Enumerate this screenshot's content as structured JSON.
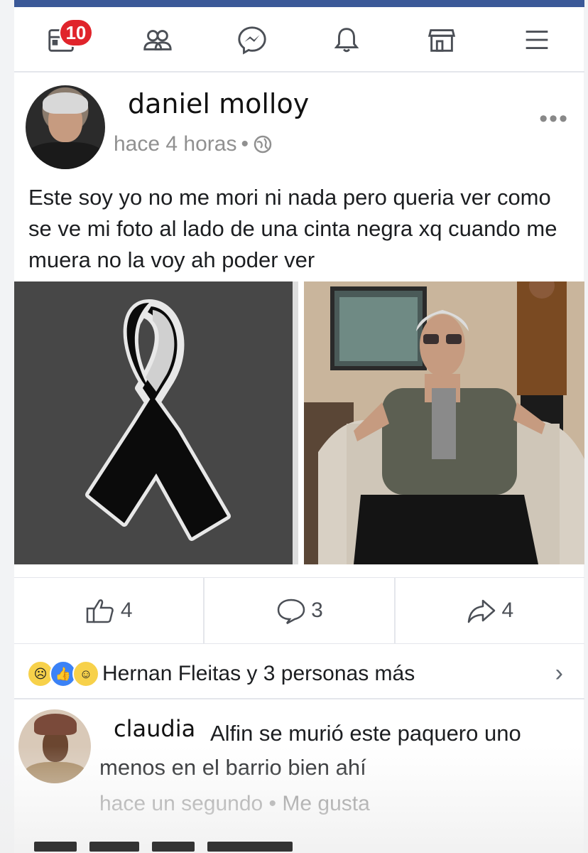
{
  "nav": {
    "notification_count": "10",
    "items": [
      "home-feed",
      "friends",
      "messenger",
      "notifications",
      "marketplace",
      "menu"
    ]
  },
  "post": {
    "author": "daniel molloy",
    "time": "hace 4 horas",
    "time_separator": "•",
    "more": "•••",
    "text": "Este soy yo no me mori ni nada pero queria ver como se ve mi foto al lado de una cinta negra xq cuando me muera no la voy ah poder ver",
    "actions": {
      "likes": "4",
      "comments": "3",
      "shares": "4"
    },
    "reactions_summary": "Hernan Fleitas y 3 personas más"
  },
  "comment": {
    "author": "claudia",
    "text": "Alfin se murió este paquero uno menos en el barrio bien ahí",
    "time": "hace un segundo",
    "separator": " • ",
    "like_label": "Me gusta"
  },
  "colors": {
    "brand_blue": "#3b5998",
    "badge_red": "#e0242b",
    "meta_gray": "#909090"
  }
}
